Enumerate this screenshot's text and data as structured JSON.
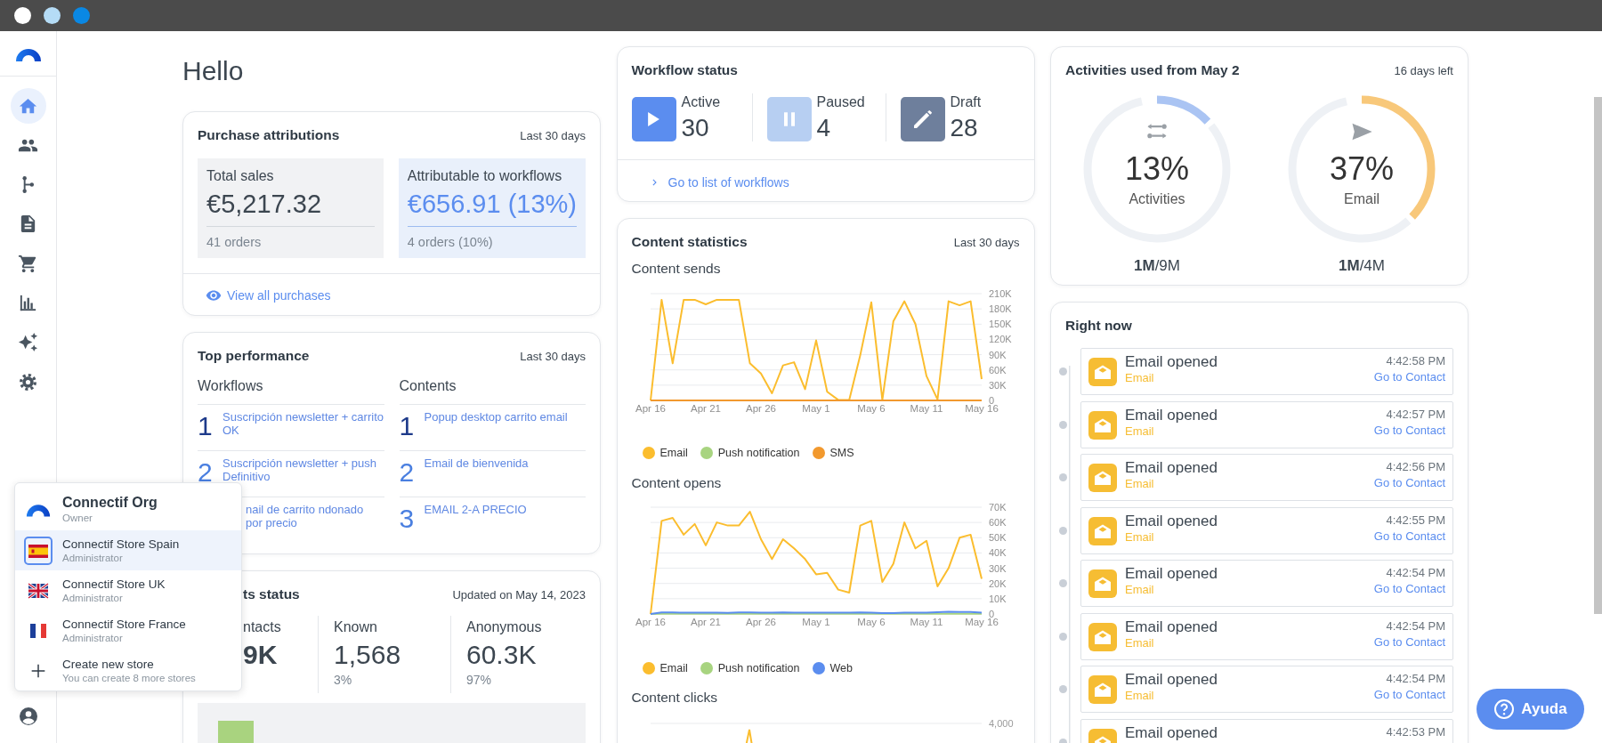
{
  "window_controls": [
    {
      "color": "#ffffff"
    },
    {
      "color": "#b5dcf6"
    },
    {
      "color": "#0a88e4"
    }
  ],
  "sidebar": {
    "items": [
      {
        "selected": true
      },
      {
        "selected": false
      },
      {
        "selected": false
      },
      {
        "selected": false
      },
      {
        "selected": false
      },
      {
        "selected": false
      },
      {
        "selected": false
      },
      {
        "selected": false
      }
    ]
  },
  "greeting": "Hello",
  "purchase_attributions": {
    "title": "Purchase attributions",
    "period": "Last 30 days",
    "stats": [
      {
        "label": "Total sales",
        "value": "€5,217.32",
        "orders": "41 orders",
        "highlighted": false
      },
      {
        "label": "Attributable to workflows",
        "value": "€656.91 (13%)",
        "orders": "4 orders (10%)",
        "highlighted": true
      }
    ],
    "link": "View all purchases"
  },
  "top_performance": {
    "title": "Top performance",
    "period": "Last 30 days",
    "columns": [
      {
        "heading": "Workflows",
        "items": [
          {
            "rank": "1",
            "name": "Suscripción newsletter + carrito OK",
            "color": "#1d3a8a"
          },
          {
            "rank": "2",
            "name": "Suscripción newsletter + push Definitivo",
            "color": "#4a7fe0"
          },
          {
            "name": "nail de carrito ndonado por precio"
          }
        ]
      },
      {
        "heading": "Contents",
        "items": [
          {
            "rank": "1",
            "name": "Popup desktop carrito email",
            "color": "#1d3a8a"
          },
          {
            "rank": "2",
            "name": "Email de bienvenida",
            "color": "#4a7fe0"
          },
          {
            "rank": "3",
            "name": "EMAIL 2-A PRECIO",
            "color": "#4a7fe0"
          }
        ]
      }
    ]
  },
  "contacts_status": {
    "title": "ts status",
    "updated": "Updated on May 14, 2023",
    "stats": [
      {
        "label": "ntacts",
        "value": "9K"
      },
      {
        "label": "Known",
        "value": "1,568",
        "share": "3%"
      },
      {
        "label": "Anonymous",
        "value": "60.3K",
        "share": "97%"
      }
    ]
  },
  "workflow_status": {
    "title": "Workflow status",
    "items": [
      {
        "kind": "active",
        "label": "Active",
        "count": "30"
      },
      {
        "kind": "paused",
        "label": "Paused",
        "count": "4"
      },
      {
        "kind": "draft",
        "label": "Draft",
        "count": "28"
      }
    ],
    "link": "Go to list of workflows"
  },
  "content_statistics": {
    "title": "Content statistics",
    "period": "Last 30 days",
    "sends": {
      "chart_data": {
        "type": "line",
        "title": "Content sends",
        "grid": true,
        "categories": [
          "Apr 16",
          null,
          null,
          null,
          null,
          "Apr 21",
          null,
          null,
          null,
          null,
          "Apr 26",
          null,
          null,
          null,
          null,
          "May 1",
          null,
          null,
          null,
          null,
          "May 6",
          null,
          null,
          null,
          null,
          "May 11",
          null,
          null,
          null,
          null,
          "May 16"
        ],
        "series": [
          {
            "name": "Email",
            "color": "#fbbd2e",
            "values": [
              0,
              198000,
              73000,
              198000,
              198000,
              189000,
              198000,
              198000,
              198000,
              73000,
              53000,
              14000,
              69000,
              75000,
              22000,
              118000,
              17000,
              1000,
              1000,
              89000,
              193000,
              1000,
              156000,
              195000,
              150000,
              48000,
              2000,
              195000,
              187000,
              195000,
              42000
            ]
          },
          {
            "name": "Push notification",
            "color": "#a8d480",
            "values": [
              null,
              null,
              null,
              null,
              null,
              null,
              null,
              null,
              null,
              null,
              null,
              null,
              null,
              null,
              null,
              null,
              null,
              null,
              null,
              null,
              null,
              null,
              null,
              null,
              null,
              null,
              null,
              null,
              null,
              null,
              null
            ]
          },
          {
            "name": "SMS",
            "color": "#f2992e",
            "values": [
              0,
              0,
              0,
              0,
              0,
              0,
              0,
              0,
              0,
              0,
              0,
              0,
              0,
              0,
              0,
              0,
              0,
              0,
              0,
              0,
              0,
              0,
              0,
              0,
              0,
              0,
              0,
              0,
              0,
              0,
              0
            ]
          }
        ],
        "ylim": [
          0,
          210000
        ],
        "yticks": [
          {
            "value": 0,
            "label": "0"
          },
          {
            "value": 30000,
            "label": "30K"
          },
          {
            "value": 60000,
            "label": "60K"
          },
          {
            "value": 90000,
            "label": "90K"
          },
          {
            "value": 120000,
            "label": "120K"
          },
          {
            "value": 150000,
            "label": "150K"
          },
          {
            "value": 180000,
            "label": "180K"
          },
          {
            "value": 210000,
            "label": "210K"
          }
        ]
      }
    },
    "opens": {
      "chart_data": {
        "type": "line",
        "title": "Content opens",
        "grid": true,
        "categories": [
          "Apr 16",
          null,
          null,
          null,
          null,
          "Apr 21",
          null,
          null,
          null,
          null,
          "Apr 26",
          null,
          null,
          null,
          null,
          "May 1",
          null,
          null,
          null,
          null,
          "May 6",
          null,
          null,
          null,
          null,
          "May 11",
          null,
          null,
          null,
          null,
          "May 16"
        ],
        "series": [
          {
            "name": "Email",
            "color": "#fbbd2e",
            "values": [
              0,
              61000,
              63000,
              52000,
              59000,
              45000,
              60000,
              58000,
              58000,
              67000,
              49000,
              36000,
              49000,
              43000,
              36000,
              26000,
              27000,
              16000,
              14000,
              58000,
              61000,
              21000,
              33000,
              60000,
              43000,
              48000,
              18000,
              30000,
              50000,
              52000,
              23000
            ]
          },
          {
            "name": "Push notification",
            "color": "#a8d480",
            "values": [
              0,
              200,
              200,
              200,
              200,
              200,
              200,
              200,
              200,
              200,
              200,
              200,
              200,
              200,
              200,
              200,
              200,
              200,
              200,
              200,
              200,
              200,
              200,
              200,
              200,
              200,
              200,
              200,
              200,
              200,
              200
            ]
          },
          {
            "name": "Web",
            "color": "#5b8def",
            "values": [
              0,
              1000,
              1000,
              800,
              800,
              900,
              800,
              700,
              1000,
              1000,
              900,
              900,
              1000,
              900,
              900,
              800,
              800,
              800,
              900,
              1000,
              900,
              500,
              500,
              900,
              800,
              900,
              1200,
              1500,
              1300,
              1300,
              900
            ]
          }
        ],
        "ylim": [
          0,
          70000
        ],
        "yticks": [
          {
            "value": 0,
            "label": "0"
          },
          {
            "value": 10000,
            "label": "10K"
          },
          {
            "value": 20000,
            "label": "20K"
          },
          {
            "value": 30000,
            "label": "30K"
          },
          {
            "value": 40000,
            "label": "40K"
          },
          {
            "value": 50000,
            "label": "50K"
          },
          {
            "value": 60000,
            "label": "60K"
          },
          {
            "value": 70000,
            "label": "70K"
          }
        ]
      }
    },
    "clicks": {
      "title": "Content clicks",
      "top_tick": "4,000"
    }
  },
  "activities": {
    "title": "Activities used from May 2",
    "remaining": "16 days left",
    "gauges": [
      {
        "percent": "13%",
        "label": "Activities",
        "level": 0.13,
        "color": "#aac4f3",
        "usage": "**1M**/9M"
      },
      {
        "percent": "37%",
        "label": "Email",
        "level": 0.37,
        "color": "#f8c87a",
        "usage": "**1M**/4M"
      }
    ]
  },
  "right_now": {
    "title": "Right now",
    "events": [
      {
        "title": "Email opened",
        "channel": "Email",
        "time": "4:42:58 PM",
        "link": "Go to Contact"
      },
      {
        "title": "Email opened",
        "channel": "Email",
        "time": "4:42:57 PM",
        "link": "Go to Contact"
      },
      {
        "title": "Email opened",
        "channel": "Email",
        "time": "4:42:56 PM",
        "link": "Go to Contact"
      },
      {
        "title": "Email opened",
        "channel": "Email",
        "time": "4:42:55 PM",
        "link": "Go to Contact"
      },
      {
        "title": "Email opened",
        "channel": "Email",
        "time": "4:42:54 PM",
        "link": "Go to Contact"
      },
      {
        "title": "Email opened",
        "channel": "Email",
        "time": "4:42:54 PM",
        "link": "Go to Contact"
      },
      {
        "title": "Email opened",
        "channel": "Email",
        "time": "4:42:54 PM",
        "link": "Go to Contact"
      },
      {
        "title": "Email opened",
        "time": "4:42:53 PM"
      }
    ]
  },
  "store_switcher": {
    "org": {
      "name": "Connectif Org",
      "role": "Owner"
    },
    "stores": [
      {
        "name": "Connectif Store Spain",
        "role": "Administrator",
        "selected": true
      },
      {
        "name": "Connectif Store UK",
        "role": "Administrator",
        "selected": false
      },
      {
        "name": "Connectif Store France",
        "role": "Administrator",
        "selected": false
      }
    ],
    "create": {
      "label": "Create new store",
      "hint": "You can create 8 more stores"
    }
  },
  "help_button": {
    "label": "Ayuda"
  }
}
